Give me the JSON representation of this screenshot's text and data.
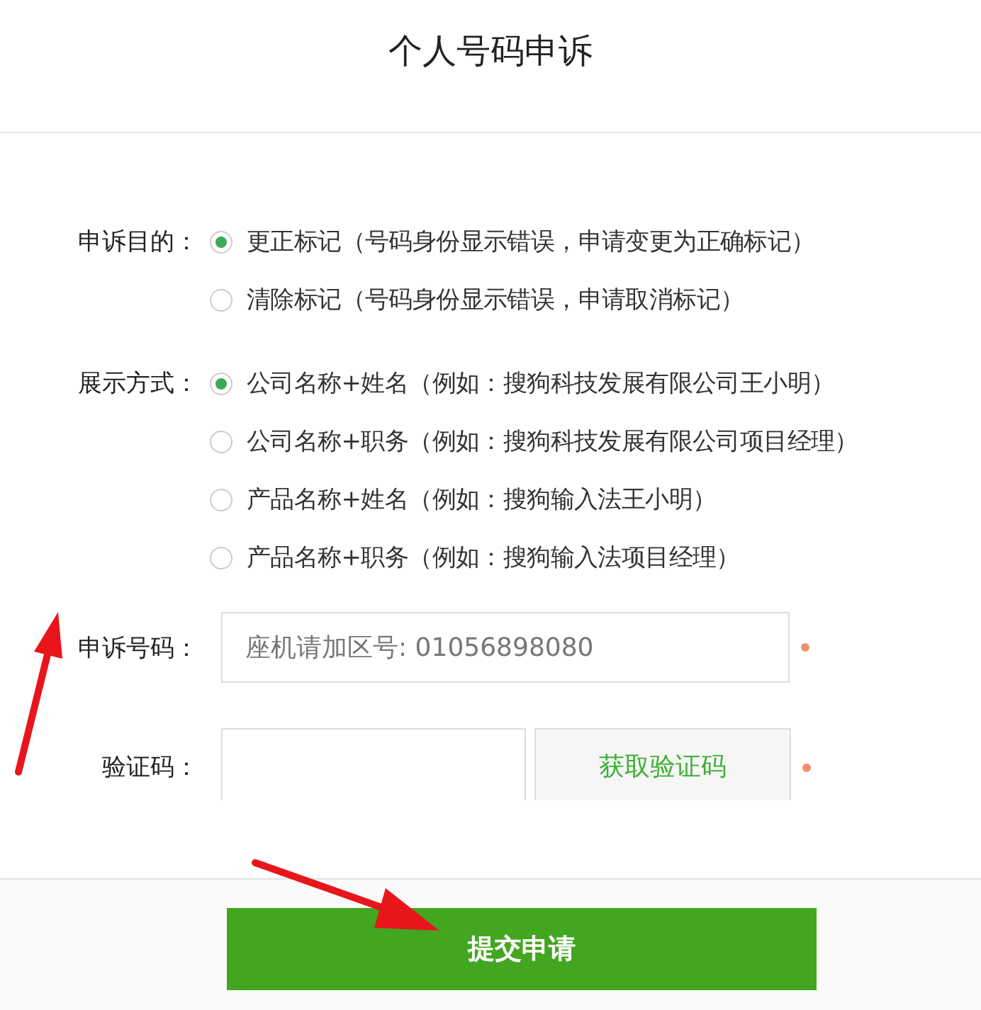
{
  "header": {
    "title": "个人号码申诉"
  },
  "radio_groups": [
    {
      "label": "申诉目的：",
      "options": [
        {
          "text": "更正标记（号码身份显示错误，申请变更为正确标记）",
          "selected": true
        },
        {
          "text": "清除标记（号码身份显示错误，申请取消标记）",
          "selected": false
        }
      ]
    },
    {
      "label": "展示方式：",
      "options": [
        {
          "text": "公司名称+姓名（例如：搜狗科技发展有限公司王小明）",
          "selected": true
        },
        {
          "text": "公司名称+职务（例如：搜狗科技发展有限公司项目经理）",
          "selected": false
        },
        {
          "text": "产品名称+姓名（例如：搜狗输入法王小明）",
          "selected": false
        },
        {
          "text": "产品名称+职务（例如：搜狗输入法项目经理）",
          "selected": false
        }
      ]
    }
  ],
  "phone": {
    "label": "申诉号码：",
    "placeholder": "座机请加区号: 01056898080"
  },
  "code": {
    "label": "验证码：",
    "button": "获取验证码"
  },
  "submit": "提交申请"
}
